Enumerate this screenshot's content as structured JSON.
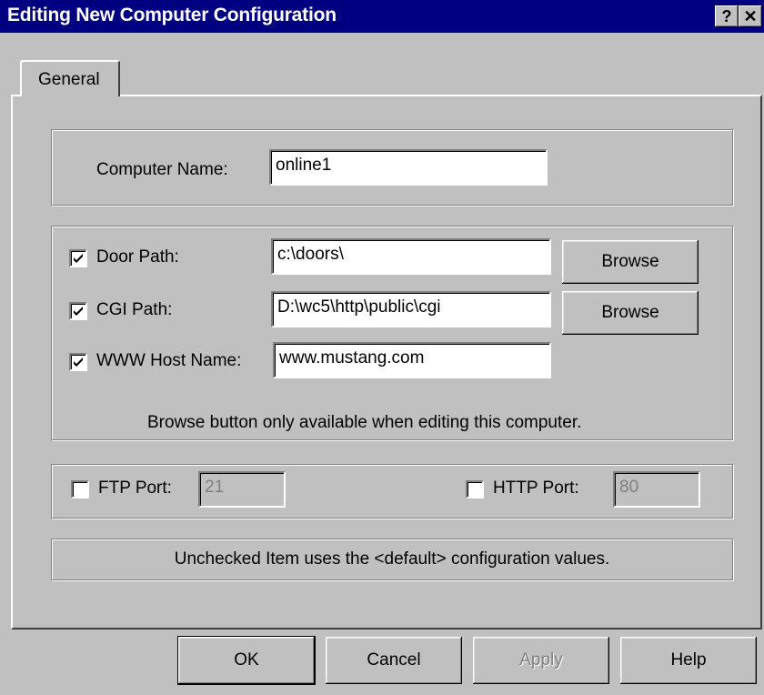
{
  "window": {
    "title": "Editing New Computer Configuration",
    "help_button": "?",
    "close_button": "✕"
  },
  "tabs": [
    {
      "label": "General",
      "selected": true
    }
  ],
  "computer_name": {
    "label": "Computer Name:",
    "value": "online1"
  },
  "paths": {
    "door_path": {
      "label": "Door Path:",
      "checked": true,
      "value": "c:\\doors\\",
      "browse_label": "Browse"
    },
    "cgi_path": {
      "label": "CGI Path:",
      "checked": true,
      "value": "D:\\wc5\\http\\public\\cgi",
      "browse_label": "Browse"
    },
    "www_host": {
      "label": "WWW Host Name:",
      "checked": true,
      "value": "www.mustang.com"
    },
    "note": "Browse button only available when editing this computer."
  },
  "ports": {
    "ftp": {
      "label": "FTP Port:",
      "checked": false,
      "value": "21"
    },
    "http": {
      "label": "HTTP Port:",
      "checked": false,
      "value": "80"
    }
  },
  "info": "Unchecked Item uses the <default> configuration values.",
  "buttons": {
    "ok": "OK",
    "cancel": "Cancel",
    "apply": "Apply",
    "help": "Help"
  }
}
